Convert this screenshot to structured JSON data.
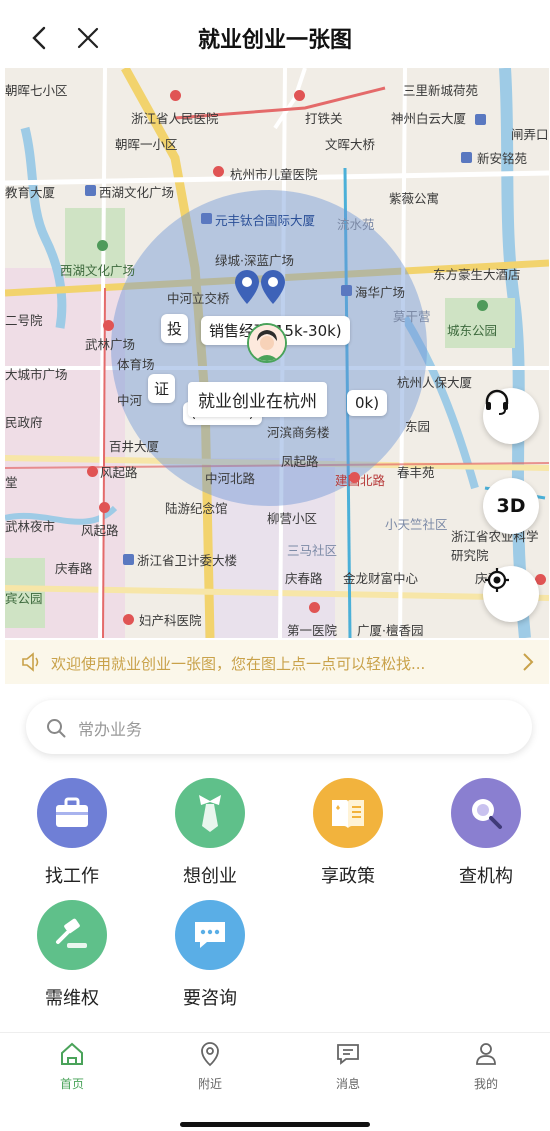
{
  "header": {
    "title": "就业创业一张图"
  },
  "map": {
    "labels": {
      "l1": "朝晖七小区",
      "l2": "浙江省人民医院",
      "l3": "打铁关",
      "l4": "三里新城荷苑",
      "l5": "神州白云大厦",
      "l6": "闸弄口",
      "l7": "朝晖一小区",
      "l8": "文晖大桥",
      "l9": "杭州市儿童医院",
      "l10": "新安铭苑",
      "l11": "教育大厦",
      "l12": "西湖文化广场",
      "l13": "紫薇公寓",
      "l14": "元丰钛合国际大厦",
      "l15": "流水苑",
      "l16": "西湖文化广场",
      "l17": "绿城·深蓝广场",
      "l18": "东方豪生大酒店",
      "l19": "中河立交桥",
      "l20": "海华广场",
      "l21": "二号院",
      "l22": "莫干营",
      "l23": "城东公园",
      "l24": "武林广场",
      "l25": "体育场",
      "l26": "大城市广场",
      "l27": "杭州人保大厦",
      "l28": "民政府",
      "l29": "中河",
      "l30": "东园",
      "l31": "百井大厦",
      "l32": "河滨商务楼",
      "l33": "风起路",
      "l34": "凤起路",
      "l35": "中河北路",
      "l36": "建国北路",
      "l37": "春丰苑",
      "l38": "陆游纪念馆",
      "l39": "武林夜市",
      "l40": "风起路",
      "l41": "柳营小区",
      "l42": "小天竺社区",
      "l43": "浙江省农业科学研究院",
      "l44": "三马社区",
      "l45": "浙江省卫计委大楼",
      "l46": "庆春路",
      "l47": "庆春路",
      "l48": "金龙财富中心",
      "l49": "庆春立",
      "l50": "妇产科医院",
      "l51": "第一医院",
      "l52": "广厦·檀香园",
      "l53": "宾公园",
      "l54": "堂"
    },
    "bubbles": {
      "b1": "投",
      "b2": "销售经理(15k-30k)",
      "b3": "证",
      "b4": "(20k-30k)",
      "b5": "0k)"
    },
    "center_label": "就业创业在杭州",
    "btn_3d": "3D"
  },
  "notice": {
    "text": "欢迎使用就业创业一张图，您在图上点一点可以轻松找..."
  },
  "search": {
    "placeholder": "常办业务"
  },
  "services": [
    {
      "label": "找工作",
      "icon": "briefcase-icon",
      "color": "#6f7fd6"
    },
    {
      "label": "想创业",
      "icon": "tie-icon",
      "color": "#5fc08a"
    },
    {
      "label": "享政策",
      "icon": "policy-book-icon",
      "color": "#f2b33d"
    },
    {
      "label": "查机构",
      "icon": "magnifier-icon",
      "color": "#8a7fd0"
    },
    {
      "label": "需维权",
      "icon": "gavel-icon",
      "color": "#5fc08a"
    },
    {
      "label": "要咨询",
      "icon": "chat-icon",
      "color": "#5aaee6"
    }
  ],
  "tabs": [
    {
      "label": "首页",
      "icon": "home-icon",
      "active": true
    },
    {
      "label": "附近",
      "icon": "location-pin-icon",
      "active": false
    },
    {
      "label": "消息",
      "icon": "message-icon",
      "active": false
    },
    {
      "label": "我的",
      "icon": "profile-icon",
      "active": false
    }
  ],
  "colors": {
    "accent": "#4aa35a",
    "notice_text": "#c9a24a",
    "map_circle": "#6e96d7"
  }
}
